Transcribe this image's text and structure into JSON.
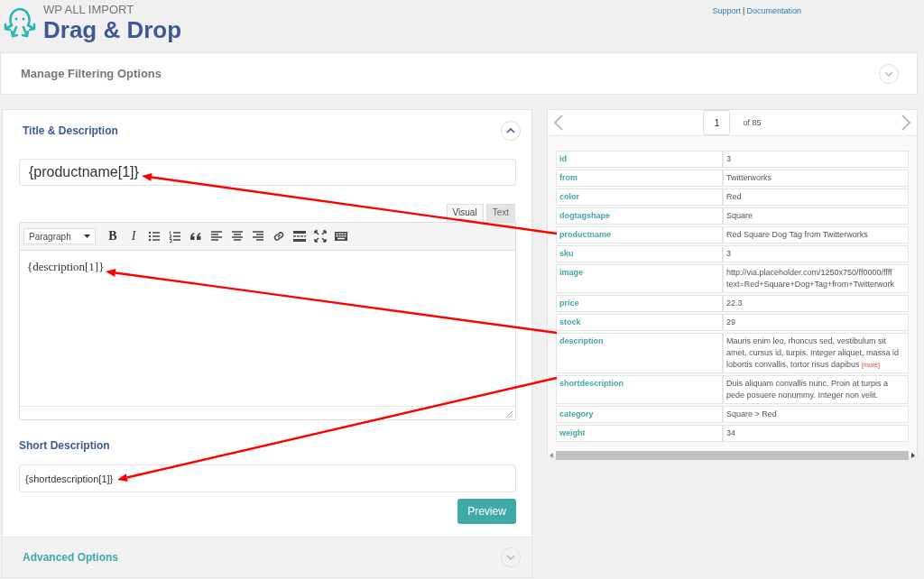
{
  "header": {
    "brand_small": "WP ALL IMPORT",
    "brand_large": "Drag & Drop",
    "links": [
      {
        "label": "Support"
      },
      {
        "label": "Documentation"
      }
    ],
    "separator": "|"
  },
  "filtering": {
    "title": "Manage Filtering Options",
    "expanded": false
  },
  "title_section": {
    "title": "Title & Description",
    "expanded": true,
    "title_value": "{productname[1]}",
    "editor_tabs": [
      {
        "label": "Visual",
        "selected": true
      },
      {
        "label": "Text",
        "selected": false
      }
    ],
    "format": "Paragraph",
    "toolbar": [
      {
        "kind": "bold",
        "label": "B"
      },
      {
        "kind": "italic",
        "label": "I"
      },
      {
        "kind": "bullets"
      },
      {
        "kind": "numbers"
      },
      {
        "kind": "quote"
      },
      {
        "kind": "align-left"
      },
      {
        "kind": "align-center"
      },
      {
        "kind": "align-right"
      },
      {
        "kind": "link"
      },
      {
        "kind": "more"
      },
      {
        "kind": "fullscreen"
      },
      {
        "kind": "keyboard"
      }
    ],
    "content": "{description[1]}",
    "short_title": "Short Description",
    "short_value": "{shortdescription[1]}",
    "preview_button": "Preview"
  },
  "advanced": {
    "title": "Advanced Options",
    "expanded": false
  },
  "record": {
    "page": "1",
    "of": "of 85",
    "rows": [
      {
        "key": "id",
        "value": "3"
      },
      {
        "key": "from",
        "value": "Twitterworks"
      },
      {
        "key": "color",
        "value": "Red"
      },
      {
        "key": "dogtagshape",
        "value": "Square"
      },
      {
        "key": "productname",
        "value": "Red Square Dog Tag from Twitterworks"
      },
      {
        "key": "sku",
        "value": "3"
      },
      {
        "key": "image",
        "value": "http://via.placeholder.com/1250x750/ff0000/ffff\ntext=Red+Square+Dog+Tag+from+Twitterwork"
      },
      {
        "key": "price",
        "value": "22.3"
      },
      {
        "key": "stock",
        "value": "29"
      },
      {
        "key": "description",
        "value": "Mauris enim leo, rhoncus sed, vestibulum sit amet, cursus id, turpis. Integer aliquet, massa id lobortis convallis, tortor risus dapibus",
        "more": "[more]"
      },
      {
        "key": "shortdescription",
        "value": "Duis aliquam convallis nunc. Proin at turpis a pede posuere nonummy. Integer non velit."
      },
      {
        "key": "category",
        "value": "Square > Red"
      },
      {
        "key": "weight",
        "value": "34"
      }
    ]
  }
}
